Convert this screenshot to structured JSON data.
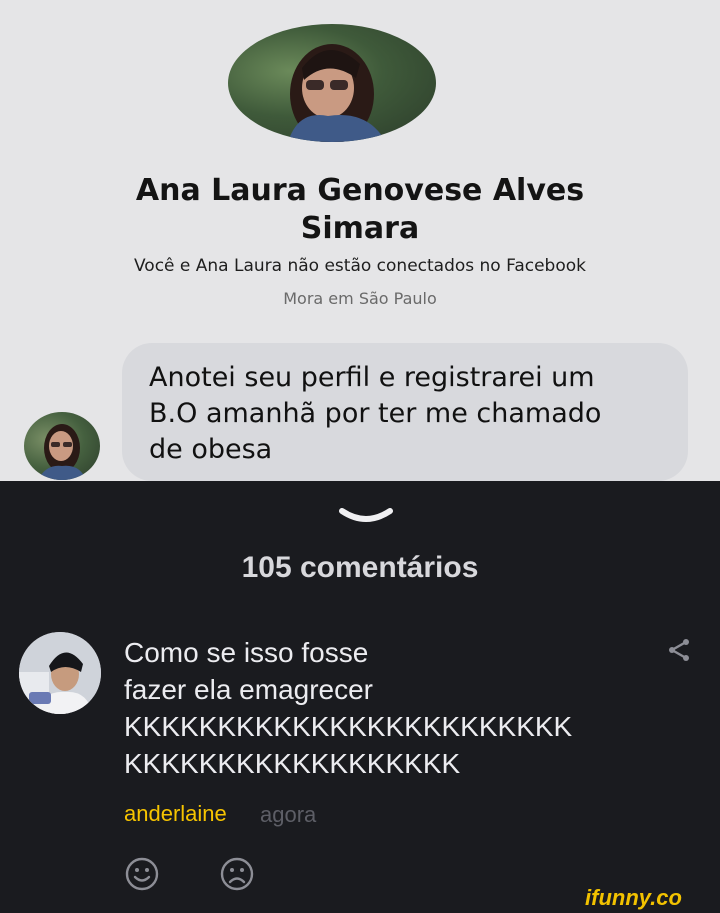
{
  "post": {
    "profile_name": "Ana Laura Genovese Alves\nSimara",
    "connection_text": "Você e Ana Laura não estão conectados no Facebook",
    "location": "Mora em São Paulo",
    "message": "Anotei seu perfil e registrarei um\nB.O amanhã por ter me chamado\nde obesa"
  },
  "comments_section": {
    "count_label": "105 comentários"
  },
  "comment": {
    "text": "Como se isso fosse\nfazer ela emagrecer\nKKKKKKKKKKKKKKKKKKKKKKKK\nKKKKKKKKKKKKKKKKKK",
    "username": "anderlaine",
    "time": "agora"
  },
  "icons": {
    "collapse": "chevron-down-icon",
    "share": "share-icon",
    "like": "smile-icon",
    "dislike": "frown-icon"
  },
  "colors": {
    "background": "#1a1b1f",
    "username": "#f6c400",
    "logo": "#f2c200"
  },
  "watermark": "ifunny.co"
}
